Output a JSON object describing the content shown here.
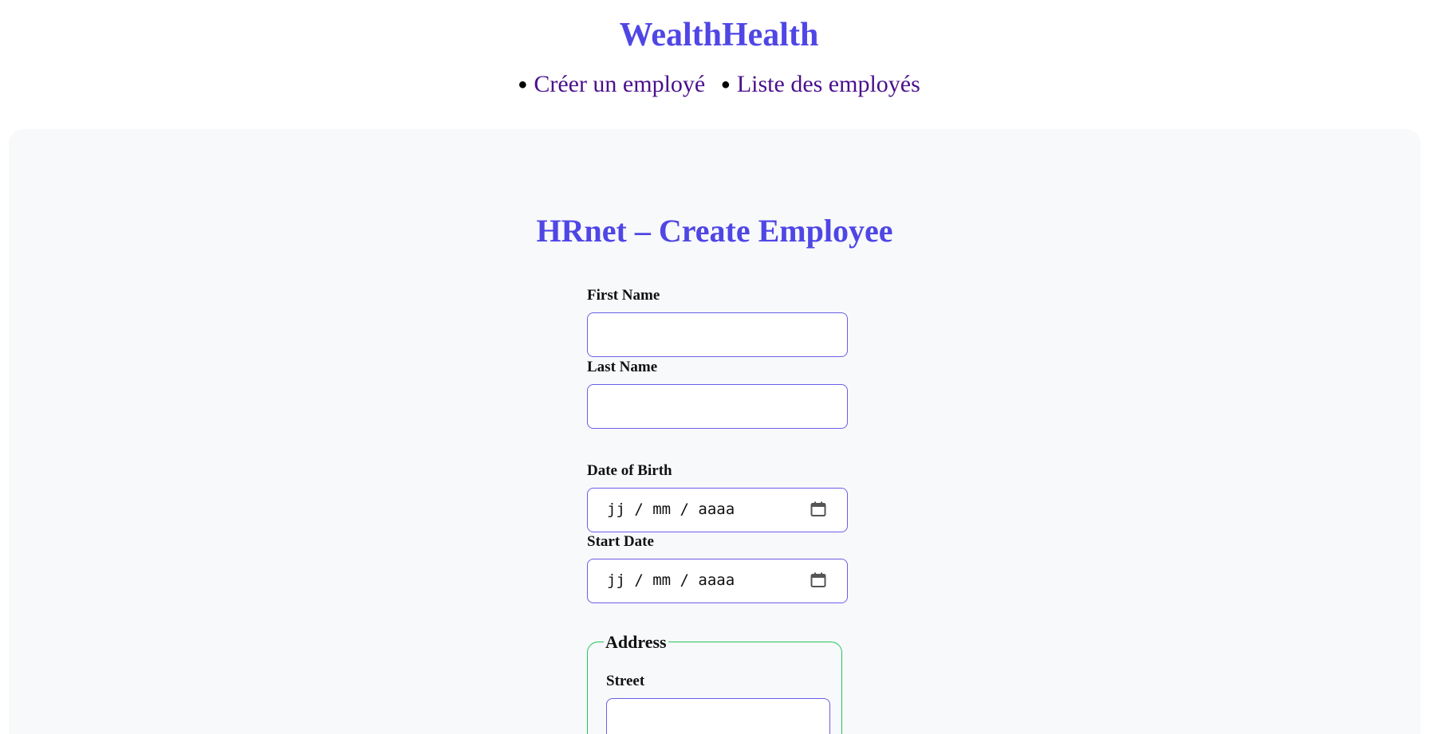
{
  "header": {
    "brand": "WealthHealth",
    "nav": [
      {
        "label": "Créer un employé"
      },
      {
        "label": "Liste des employés"
      }
    ]
  },
  "form": {
    "title": "HRnet – Create Employee",
    "first_name_label": "First Name",
    "first_name_value": "",
    "last_name_label": "Last Name",
    "last_name_value": "",
    "date_of_birth_label": "Date of Birth",
    "date_of_birth_placeholder": "jj / mm / aaaa",
    "start_date_label": "Start Date",
    "start_date_placeholder": "jj / mm / aaaa",
    "address": {
      "legend": "Address",
      "street_label": "Street",
      "street_value": ""
    }
  },
  "icons": {
    "date_picker": "calendar-icon"
  },
  "colors": {
    "accent": "#4f46e5",
    "link": "#4b0f8c",
    "input_border": "#6a5ee8",
    "fieldset_border": "#22c55e",
    "panel_bg": "#f8f9fb"
  }
}
